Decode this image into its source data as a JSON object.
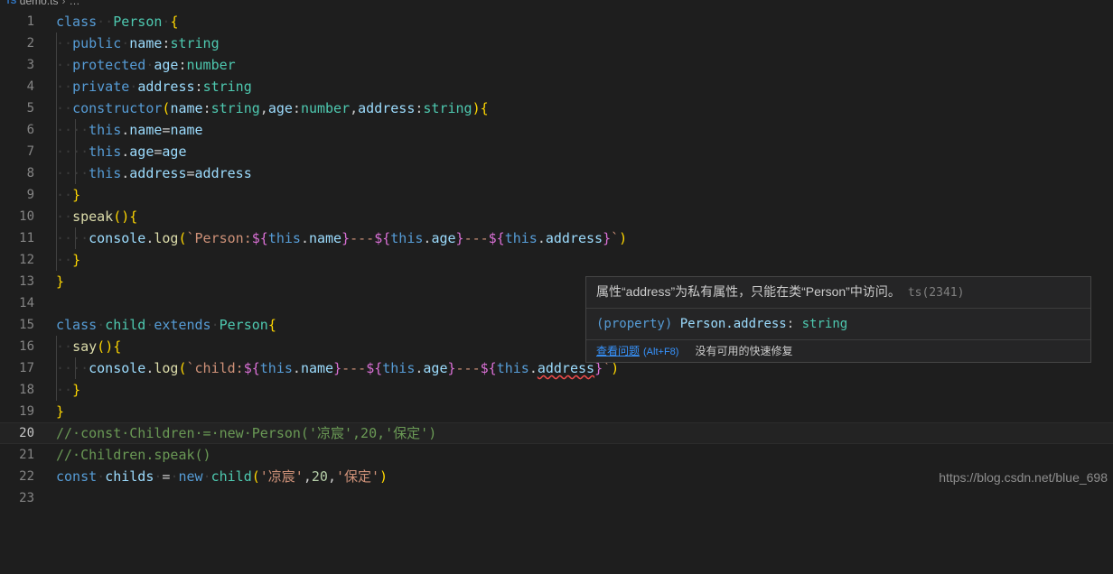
{
  "breadcrumb": {
    "file_icon": "TS",
    "file": "demo.ts",
    "separator": "›",
    "rest": "…"
  },
  "editor": {
    "language": "typescript",
    "active_line": 20,
    "theme_background": "#1e1e1e",
    "line_numbers": [
      "1",
      "2",
      "3",
      "4",
      "5",
      "6",
      "7",
      "8",
      "9",
      "10",
      "11",
      "12",
      "13",
      "14",
      "15",
      "16",
      "17",
      "18",
      "19",
      "20",
      "21",
      "22",
      "23"
    ],
    "code_lines": [
      "class  Person {",
      "  public name:string",
      "  protected age:number",
      "  private address:string",
      "  constructor(name:string,age:number,address:string){",
      "    this.name=name",
      "    this.age=age",
      "    this.address=address",
      "  }",
      "  speak(){",
      "    console.log(`Person:${this.name}---${this.age}---${this.address}`)",
      "  }",
      "}",
      "",
      "class child extends Person{",
      "  say(){",
      "    console.log(`child:${this.name}---${this.age}---${this.address}`)",
      "  }",
      "}",
      "// const Children = new Person('凉宸',20,'保定')",
      "// Children.speak()",
      "const childs = new child('凉宸',20,'保定')",
      ""
    ]
  },
  "hover": {
    "diagnostic_message": "属性“address”为私有属性，只能在类“Person”中访问。",
    "diagnostic_code": "ts(2341)",
    "signature": "(property) Person.address: string",
    "signature_parts": {
      "property_kw": "(property)",
      "symbol": "Person.address",
      "colon": ":",
      "type": "string"
    },
    "action_link": "查看问题",
    "action_shortcut": "(Alt+F8)",
    "action_none": "没有可用的快速修复"
  },
  "watermark": {
    "text": "https://blog.csdn.net/blue_698"
  }
}
